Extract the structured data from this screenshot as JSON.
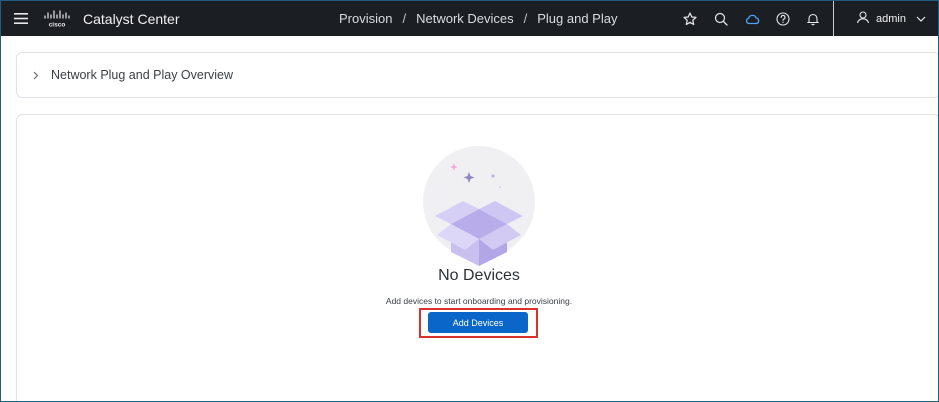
{
  "header": {
    "app_title": "Catalyst Center",
    "logo_text": "cisco",
    "breadcrumb": [
      "Provision",
      "Network Devices",
      "Plug and Play"
    ],
    "breadcrumb_separator": "/",
    "user_name": "admin",
    "icons": [
      "menu-icon",
      "cisco-logo",
      "star-icon",
      "search-icon",
      "cloud-icon",
      "help-icon",
      "bell-icon",
      "user-icon",
      "chevron-down-icon"
    ]
  },
  "overview": {
    "label": "Network Plug and Play Overview"
  },
  "empty_state": {
    "title": "No Devices",
    "subtitle": "Add devices to start onboarding and provisioning.",
    "button_label": "Add Devices"
  },
  "colors": {
    "topbar": "#1b1e22",
    "primary_button": "#0a66c8",
    "highlight": "#d9342b",
    "illustration": "#c9c0ec"
  }
}
